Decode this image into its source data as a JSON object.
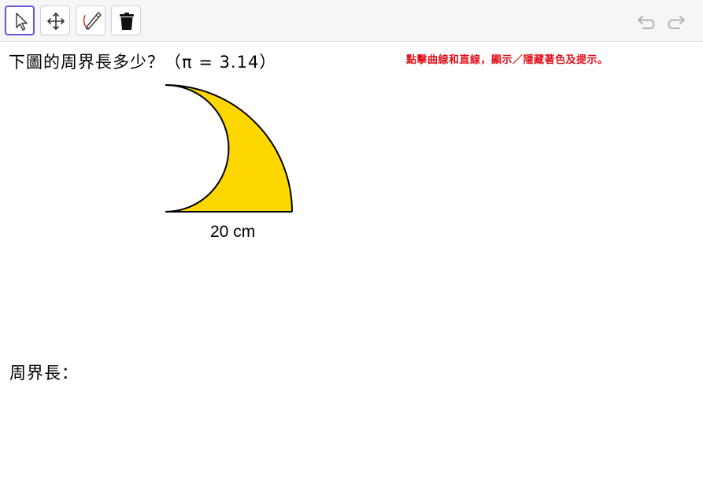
{
  "toolbar": {
    "tools": [
      {
        "name": "move-tool-icon",
        "selected": true
      },
      {
        "name": "move-graphics-view-icon",
        "selected": false
      },
      {
        "name": "pen-icon",
        "selected": false
      },
      {
        "name": "delete-icon",
        "selected": false
      }
    ],
    "undo_icon": "undo-icon",
    "redo_icon": "redo-icon"
  },
  "canvas": {
    "question": "下圖的周界長多少？（π = 3.14）",
    "hint": "點擊曲線和直線，顯示／隱藏著色及提示。",
    "figure": {
      "shape": "quarter-circle-minus-semicircle",
      "fill_color": "#FFD700",
      "stroke_color": "#000000",
      "base_label": "20 cm"
    },
    "answer_label": "周界長："
  },
  "colors": {
    "hint_text": "#E0101A",
    "selected_tool_border": "#6557D2"
  }
}
